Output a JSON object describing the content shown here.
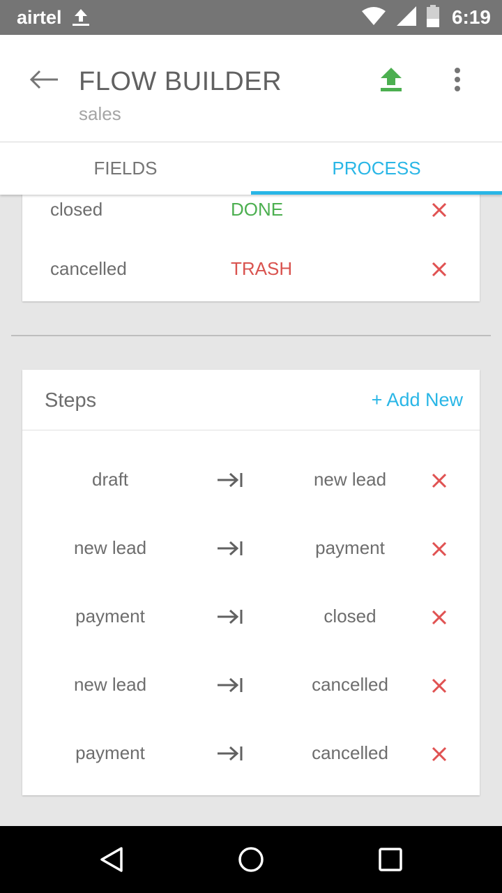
{
  "status_bar": {
    "carrier": "airtel",
    "time": "6:19",
    "icons": [
      "upload-icon",
      "wifi-icon",
      "signal-icon",
      "battery-icon"
    ]
  },
  "app_bar": {
    "title": "FLOW BUILDER",
    "subtitle": "sales",
    "actions": [
      "back-arrow-icon",
      "upload-icon",
      "more-vert-icon"
    ],
    "upload_color": "#4caf50"
  },
  "tabs": [
    {
      "label": "FIELDS",
      "active": false
    },
    {
      "label": "PROCESS",
      "active": true
    }
  ],
  "states": [
    {
      "name": "closed",
      "tag": "DONE",
      "tag_color": "#4caf50"
    },
    {
      "name": "cancelled",
      "tag": "TRASH",
      "tag_color": "#d9534f"
    }
  ],
  "steps": {
    "title": "Steps",
    "add_label": "+ Add New",
    "rows": [
      {
        "from": "draft",
        "to": "new lead"
      },
      {
        "from": "new lead",
        "to": "payment"
      },
      {
        "from": "payment",
        "to": "closed"
      },
      {
        "from": "new lead",
        "to": "cancelled"
      },
      {
        "from": "payment",
        "to": "cancelled"
      }
    ]
  },
  "colors": {
    "accent": "#29b6e6",
    "delete": "#e05252",
    "done": "#4caf50",
    "trash": "#d9534f"
  },
  "nav_bar": {
    "icons": [
      "nav-back-icon",
      "nav-home-icon",
      "nav-recents-icon"
    ]
  }
}
